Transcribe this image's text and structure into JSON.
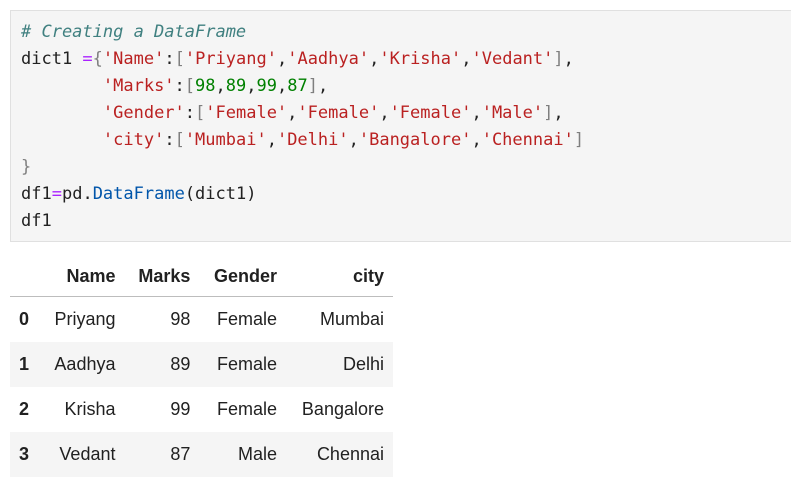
{
  "code": {
    "comment": "# Creating a DataFrame",
    "line2_var": "dict1 ",
    "line2_eq": "=",
    "line2_brace": "{",
    "key_name": "'Name'",
    "colon": ":",
    "lbr": "[",
    "rbr": "]",
    "comma": ",",
    "names": [
      "'Priyang'",
      "'Aadhya'",
      "'Krisha'",
      "'Vedant'"
    ],
    "key_marks": "'Marks'",
    "marks": [
      "98",
      "89",
      "99",
      "87"
    ],
    "key_gender": "'Gender'",
    "genders": [
      "'Female'",
      "'Female'",
      "'Female'",
      "'Male'"
    ],
    "key_city": "'city'",
    "cities": [
      "'Mumbai'",
      "'Delhi'",
      "'Bangalore'",
      "'Chennai'"
    ],
    "close_brace": "}",
    "line7_a": "df1",
    "line7_eq": "=",
    "line7_b": "pd.",
    "line7_c": "DataFrame",
    "line7_d": "(dict1)",
    "line8": "df1"
  },
  "table": {
    "headers": [
      "",
      "Name",
      "Marks",
      "Gender",
      "city"
    ],
    "rows": [
      {
        "index": "0",
        "name": "Priyang",
        "marks": "98",
        "gender": "Female",
        "city": "Mumbai"
      },
      {
        "index": "1",
        "name": "Aadhya",
        "marks": "89",
        "gender": "Female",
        "city": "Delhi"
      },
      {
        "index": "2",
        "name": "Krisha",
        "marks": "99",
        "gender": "Female",
        "city": "Bangalore"
      },
      {
        "index": "3",
        "name": "Vedant",
        "marks": "87",
        "gender": "Male",
        "city": "Chennai"
      }
    ]
  }
}
